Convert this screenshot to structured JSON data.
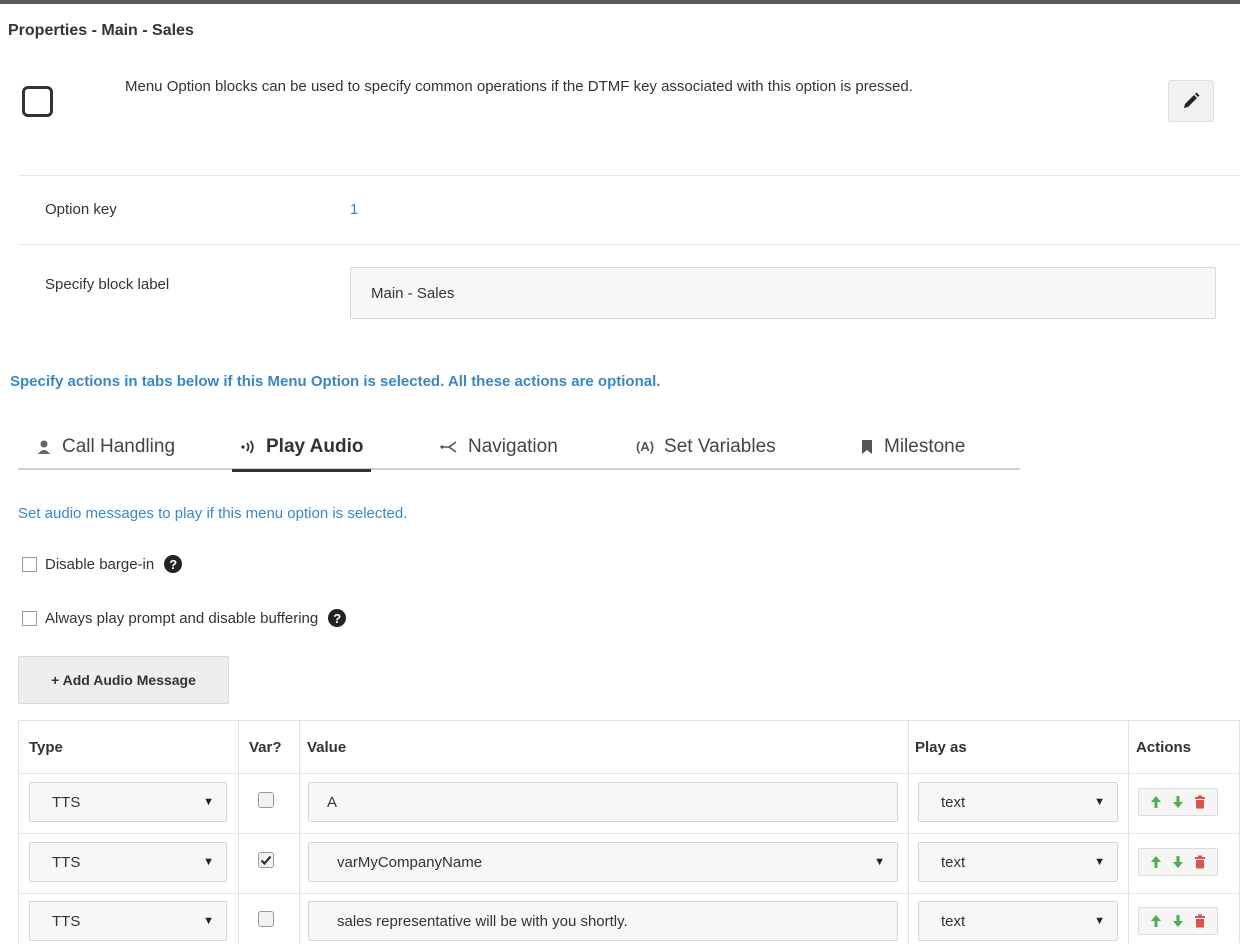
{
  "panel": {
    "title": "Properties - Main - Sales",
    "description": "Menu Option blocks can be used to specify common operations if the DTMF key associated with this option is pressed.",
    "edit_icon": "pencil-icon"
  },
  "fields": {
    "option_key_label": "Option key",
    "option_key_value": "1",
    "block_label_label": "Specify block label",
    "block_label_value": "Main - Sales"
  },
  "actions_info": "Specify actions in tabs below if this Menu Option is selected. All these actions are optional.",
  "tabs": [
    {
      "label": "Call Handling",
      "icon": "person-icon",
      "active": false
    },
    {
      "label": "Play Audio",
      "icon": "sound-icon",
      "active": true
    },
    {
      "label": "Navigation",
      "icon": "branch-icon",
      "active": false
    },
    {
      "label": "Set Variables",
      "icon": "variable-icon",
      "icon_text": "(A)",
      "active": false
    },
    {
      "label": "Milestone",
      "icon": "bookmark-icon",
      "active": false
    }
  ],
  "play_audio": {
    "info": "Set audio messages to play if this menu option is selected.",
    "disable_bargein_label": "Disable barge-in",
    "disable_bargein_checked": false,
    "always_play_label": "Always play prompt and disable buffering",
    "always_play_checked": false,
    "help_glyph": "?",
    "add_button_label": "+ Add Audio Message"
  },
  "table": {
    "headers": {
      "type": "Type",
      "var": "Var?",
      "value": "Value",
      "play_as": "Play as",
      "actions": "Actions"
    },
    "rows": [
      {
        "type": "TTS",
        "var": false,
        "value": "A",
        "value_is_dropdown": false,
        "play_as": "text"
      },
      {
        "type": "TTS",
        "var": true,
        "value": "varMyCompanyName",
        "value_is_dropdown": true,
        "play_as": "text"
      },
      {
        "type": "TTS",
        "var": false,
        "value": "sales representative will be with you shortly.",
        "value_is_dropdown": false,
        "play_as": "text"
      }
    ]
  },
  "colors": {
    "link_blue": "#3a87c8",
    "arrow_green": "#4caf50",
    "delete_red": "#d9534f"
  }
}
